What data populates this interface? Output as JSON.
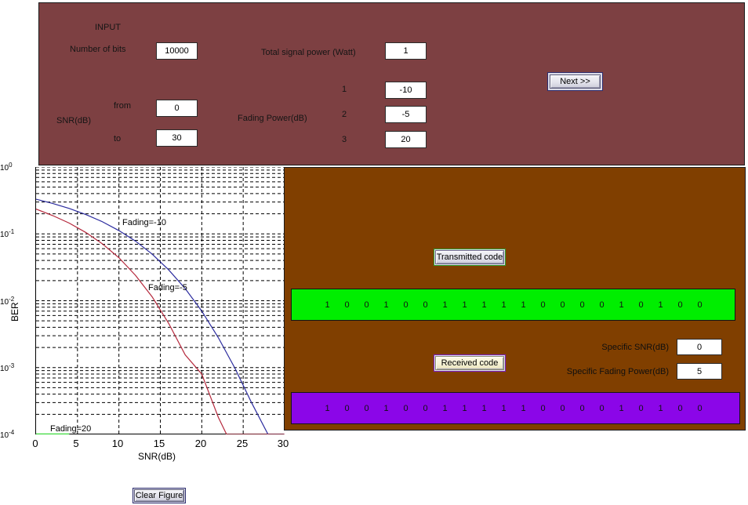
{
  "input_panel": {
    "section_title": "INPUT",
    "number_of_bits_label": "Number of bits",
    "number_of_bits_value": "10000",
    "total_signal_power_label": "Total signal power (Watt)",
    "total_signal_power_value": "1",
    "snr_label": "SNR(dB)",
    "snr_from_label": "from",
    "snr_from_value": "0",
    "snr_to_label": "to",
    "snr_to_value": "30",
    "fading_power_label": "Fading Power(dB)",
    "fading_rows": [
      {
        "index": "1",
        "value": "-10"
      },
      {
        "index": "2",
        "value": "-5"
      },
      {
        "index": "3",
        "value": "20"
      }
    ],
    "next_button": "Next >>",
    "background_color": "#7d4042"
  },
  "chart_data": {
    "type": "line",
    "title": "",
    "xlabel": "SNR(dB)",
    "ylabel": "BER",
    "xlim": [
      0,
      30
    ],
    "ylim": [
      0.0001,
      1
    ],
    "yscale": "log",
    "xticks": [
      "0",
      "5",
      "10",
      "15",
      "20",
      "25",
      "30"
    ],
    "yticks": [
      "10^0",
      "10^-1",
      "10^-2",
      "10^-3",
      "10^-4"
    ],
    "ytick_labels": [
      "10",
      "10",
      "10",
      "10",
      "10"
    ],
    "ytick_exponents": [
      "0",
      "-1",
      "-2",
      "-3",
      "-4"
    ],
    "grid": true,
    "grid_style": "dashed",
    "legend_position": "inline-annotation",
    "series": [
      {
        "name": "Fading=-10",
        "color": "#2b2b9e",
        "annotation": "Fading=-10",
        "x": [
          0,
          2,
          4,
          6,
          8,
          10,
          12,
          14,
          16,
          18,
          20,
          22,
          24,
          26,
          28,
          30
        ],
        "y": [
          0.33,
          0.285,
          0.24,
          0.195,
          0.152,
          0.112,
          0.078,
          0.05,
          0.029,
          0.0152,
          0.007,
          0.0028,
          0.00098,
          0.0003,
          0.0001,
          0.0001
        ]
      },
      {
        "name": "Fading=-5",
        "color": "#b5283c",
        "annotation": "Fading=-5",
        "x": [
          0,
          2,
          4,
          6,
          8,
          10,
          12,
          14,
          16,
          18,
          20,
          22,
          23,
          25,
          30
        ],
        "y": [
          0.235,
          0.188,
          0.145,
          0.105,
          0.071,
          0.044,
          0.024,
          0.0115,
          0.0046,
          0.00155,
          0.0008,
          0.00018,
          0.0001,
          0.0001,
          0.0001
        ]
      },
      {
        "name": "Fading=20",
        "color": "#3cdb3c",
        "annotation": "Fading=20",
        "x": [
          0,
          4
        ],
        "y": [
          0.0001,
          0.0001
        ]
      }
    ]
  },
  "result_panel": {
    "transmitted_button": "Transmitted code",
    "received_button": "Received code",
    "transmitted_bits": [
      "1",
      "0",
      "0",
      "1",
      "0",
      "0",
      "1",
      "1",
      "1",
      "1",
      "1",
      "0",
      "0",
      "0",
      "0",
      "1",
      "0",
      "1",
      "0",
      "0"
    ],
    "received_bits": [
      "1",
      "0",
      "0",
      "1",
      "0",
      "0",
      "1",
      "1",
      "1",
      "1",
      "1",
      "0",
      "0",
      "0",
      "0",
      "1",
      "0",
      "1",
      "0",
      "0"
    ],
    "transmitted_bar_color": "#00ee00",
    "received_bar_color": "#8b06e8",
    "specific_snr_label": "Specific SNR(dB)",
    "specific_snr_value": "0",
    "specific_fading_label": "Specific Fading Power(dB)",
    "specific_fading_value": "5",
    "background_color": "#803f00"
  },
  "footer": {
    "clear_figure_button": "Clear Figure"
  }
}
